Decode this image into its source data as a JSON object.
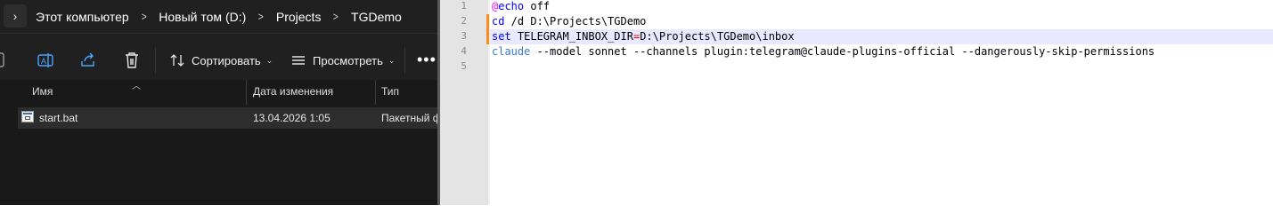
{
  "explorer": {
    "address": {
      "crumbs": [
        "Этот компьютер",
        "Новый том (D:)",
        "Projects",
        "TGDemo"
      ]
    },
    "toolbar": {
      "sort_label": "Сортировать",
      "view_label": "Просмотреть",
      "more_label": "•••"
    },
    "columns": {
      "name": "Имя",
      "date": "Дата изменения",
      "type": "Тип"
    },
    "files": [
      {
        "name": "start.bat",
        "date": "13.04.2026 1:05",
        "type": "Пакетный ф"
      }
    ]
  },
  "editor": {
    "lines": [
      {
        "num": "1",
        "parts": [
          {
            "t": "@",
            "c": "at"
          },
          {
            "t": "echo",
            "c": "kw"
          },
          {
            "t": " off",
            "c": ""
          }
        ]
      },
      {
        "num": "2",
        "parts": [
          {
            "t": "cd",
            "c": "kw"
          },
          {
            "t": " /d D:\\Projects\\TGDemo",
            "c": ""
          }
        ]
      },
      {
        "num": "3",
        "parts": [
          {
            "t": "set",
            "c": "kw"
          },
          {
            "t": " TELEGRAM_INBOX_DIR",
            "c": ""
          },
          {
            "t": "=",
            "c": "op"
          },
          {
            "t": "D:\\Projects\\TGDemo\\inbox",
            "c": ""
          }
        ]
      },
      {
        "num": "4",
        "parts": [
          {
            "t": "claude",
            "c": "cmd"
          },
          {
            "t": " --model sonnet --channels plugin:telegram@claude-plugins-official --dangerously-skip-permissions",
            "c": ""
          }
        ]
      },
      {
        "num": "5",
        "parts": []
      }
    ],
    "current_line": 3,
    "changed_lines": [
      2,
      3
    ]
  }
}
